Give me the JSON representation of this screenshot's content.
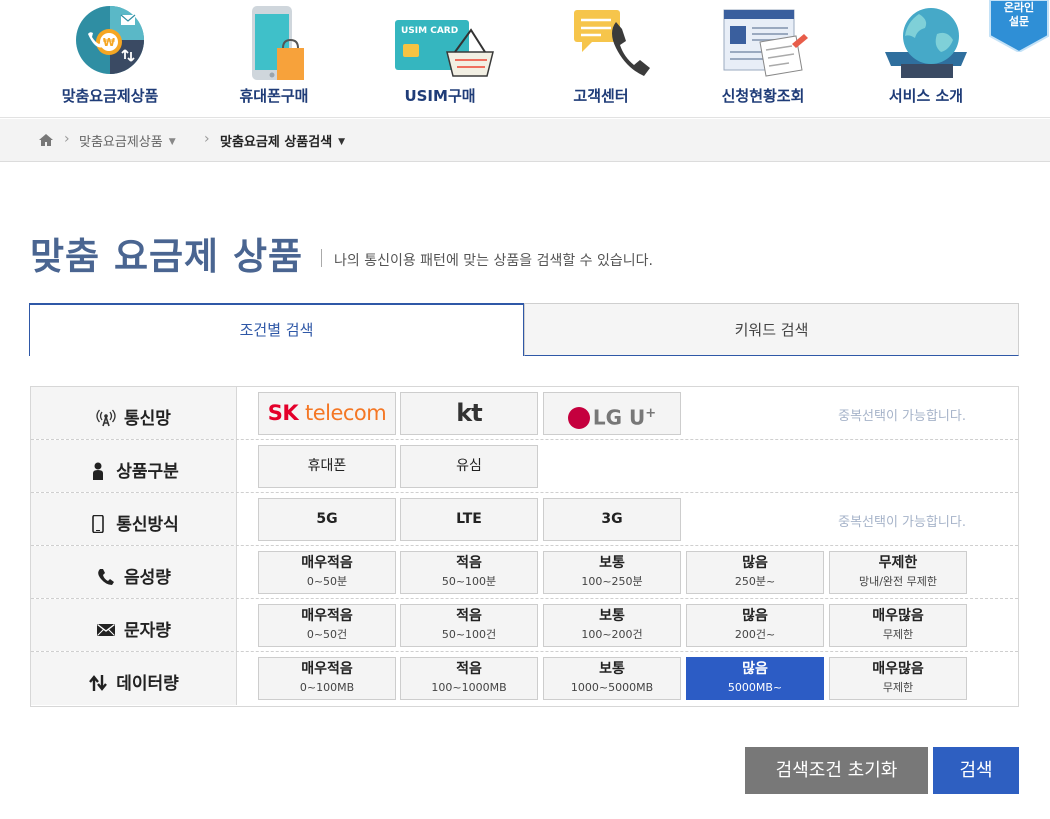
{
  "nav": {
    "items": [
      {
        "label": "맞춤요금제상품"
      },
      {
        "label": "휴대폰구매"
      },
      {
        "label": "USIM구매"
      },
      {
        "label": "고객센터"
      },
      {
        "label": "신청현황조회"
      },
      {
        "label": "서비스 소개"
      }
    ],
    "usim_card_text": "USIM CARD",
    "survey_line1": "온라인",
    "survey_line2": "설문"
  },
  "breadcrumb": {
    "level1": "맞춤요금제상품",
    "level2": "맞춤요금제 상품검색"
  },
  "page": {
    "title": "맞춤 요금제 상품",
    "subtitle": "나의 통신이용 패턴에 맞는 상품을 검색할 수 있습니다."
  },
  "tabs": {
    "condition": "조건별 검색",
    "keyword": "키워드 검색"
  },
  "filters": {
    "carrier": {
      "label": "통신망",
      "options": [
        "SK telecom",
        "kt",
        "LG U+"
      ],
      "note": "중복선택이 가능합니다."
    },
    "product_type": {
      "label": "상품구분",
      "options": [
        "휴대폰",
        "유심"
      ]
    },
    "network": {
      "label": "통신방식",
      "options": [
        "5G",
        "LTE",
        "3G"
      ],
      "note": "중복선택이 가능합니다."
    },
    "voice": {
      "label": "음성량",
      "options": [
        {
          "main": "매우적음",
          "sub": "0~50분"
        },
        {
          "main": "적음",
          "sub": "50~100분"
        },
        {
          "main": "보통",
          "sub": "100~250분"
        },
        {
          "main": "많음",
          "sub": "250분~"
        },
        {
          "main": "무제한",
          "sub": "망내/완전 무제한"
        }
      ]
    },
    "sms": {
      "label": "문자량",
      "options": [
        {
          "main": "매우적음",
          "sub": "0~50건"
        },
        {
          "main": "적음",
          "sub": "50~100건"
        },
        {
          "main": "보통",
          "sub": "100~200건"
        },
        {
          "main": "많음",
          "sub": "200건~"
        },
        {
          "main": "매우많음",
          "sub": "무제한"
        }
      ]
    },
    "data": {
      "label": "데이터량",
      "options": [
        {
          "main": "매우적음",
          "sub": "0~100MB"
        },
        {
          "main": "적음",
          "sub": "100~1000MB"
        },
        {
          "main": "보통",
          "sub": "1000~5000MB"
        },
        {
          "main": "많음",
          "sub": "5000MB~",
          "selected": true
        },
        {
          "main": "매우많음",
          "sub": "무제한"
        }
      ]
    }
  },
  "buttons": {
    "reset": "검색조건 초기화",
    "search": "검색"
  },
  "colors": {
    "brand_blue": "#2e5fc1",
    "title_blue": "#4a6591",
    "selected_option": "#2c5cc5",
    "reset_gray": "#787878",
    "sk_red": "#e4002b",
    "sk_orange": "#f47725",
    "lg_magenta": "#c5003e"
  }
}
